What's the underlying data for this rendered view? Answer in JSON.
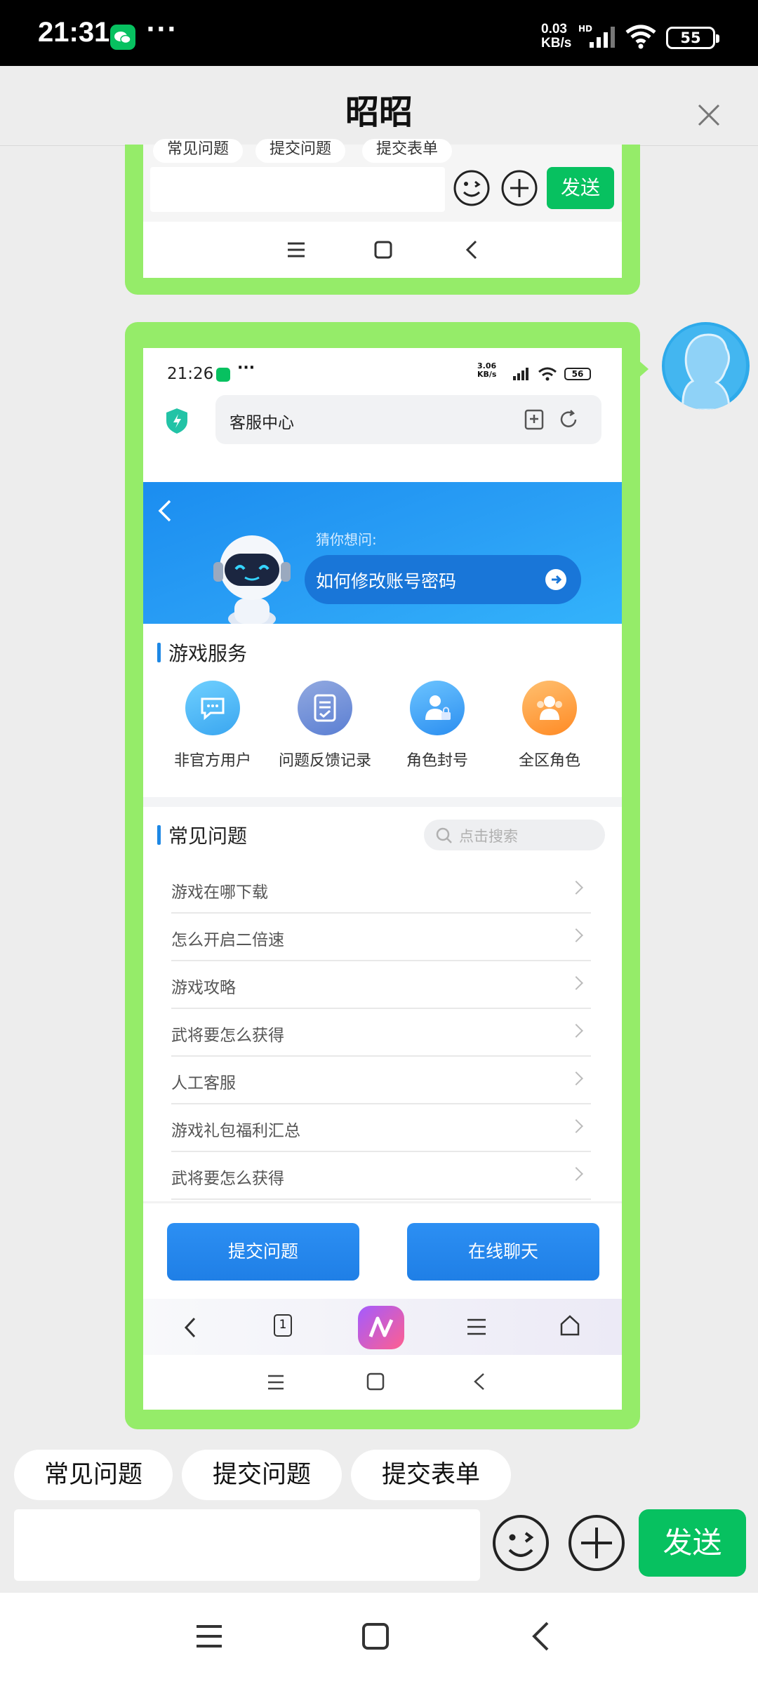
{
  "status_bar": {
    "time": "21:31",
    "net_speed_value": "0.03",
    "net_speed_unit": "KB/s",
    "hd": "HD",
    "battery": "55"
  },
  "chat": {
    "title": "昭昭"
  },
  "bubble1": {
    "quick_replies": [
      "常见问题",
      "提交问题",
      "提交表单"
    ],
    "send_label": "发送"
  },
  "inner": {
    "status": {
      "time": "21:26",
      "net_speed_value": "3.06",
      "net_speed_unit": "KB/s",
      "battery": "56"
    },
    "address_bar": {
      "title": "客服中心"
    },
    "banner": {
      "hint": "猜你想问:",
      "question": "如何修改账号密码"
    },
    "game_service": {
      "title": "游戏服务",
      "items": [
        {
          "label": "非官方用户",
          "icon": "chat-bubble-icon",
          "color": "#4ab8f5"
        },
        {
          "label": "问题反馈记录",
          "icon": "document-check-icon",
          "color": "#6a8fe0"
        },
        {
          "label": "角色封号",
          "icon": "user-lock-icon",
          "color": "#3a9cf0"
        },
        {
          "label": "全区角色",
          "icon": "users-icon",
          "color": "#ff9a2e"
        }
      ]
    },
    "faq": {
      "title": "常见问题",
      "search_placeholder": "点击搜索",
      "items": [
        "游戏在哪下载",
        "怎么开启二倍速",
        "游戏攻略",
        "武将要怎么获得",
        "人工客服",
        "游戏礼包福利汇总",
        "武将要怎么获得"
      ]
    },
    "buttons": {
      "submit": "提交问题",
      "chat": "在线聊天"
    },
    "browser_nav": {
      "tab_count": "1"
    }
  },
  "quick_replies": [
    "常见问题",
    "提交问题",
    "提交表单"
  ],
  "input": {
    "value": ""
  },
  "send_label": "发送",
  "colors": {
    "bubble": "#95ec69",
    "send": "#07c160",
    "accent": "#1e88e5"
  }
}
